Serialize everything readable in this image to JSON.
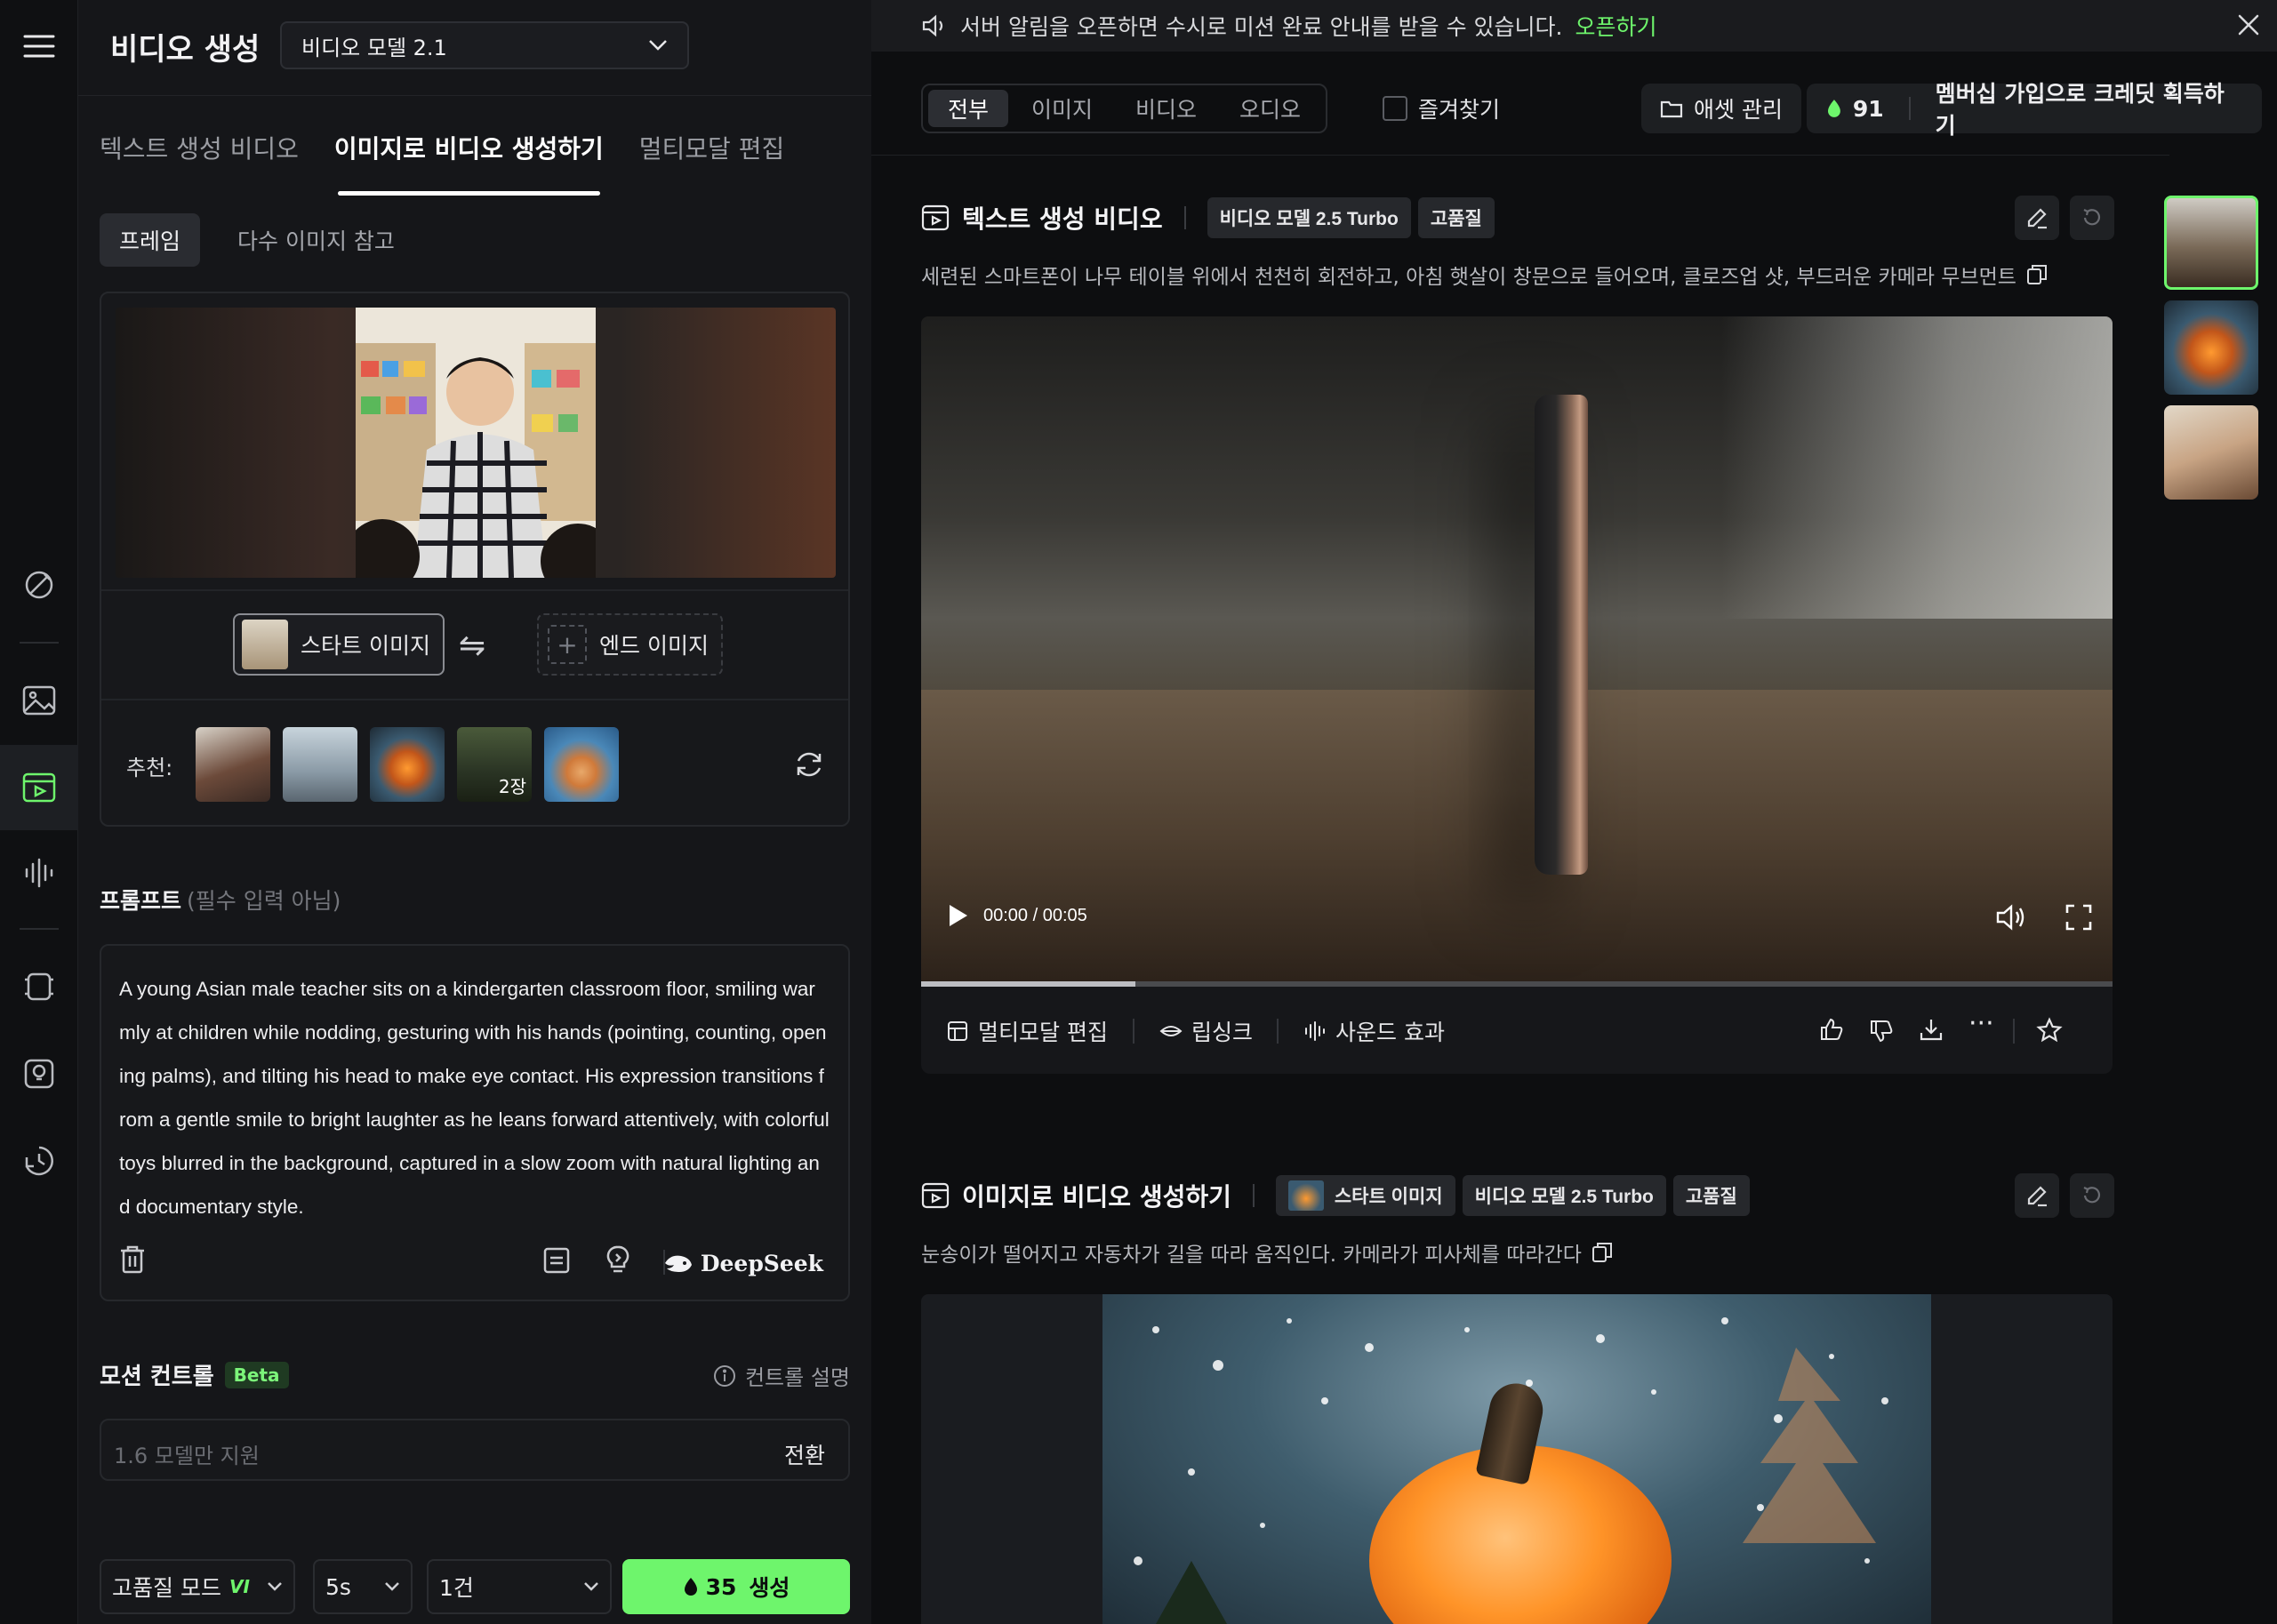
{
  "app": {
    "title": "비디오 생성",
    "model_select": "비디오 모델 2.1"
  },
  "mode_tabs": [
    "텍스트 생성 비디오",
    "이미지로 비디오 생성하기",
    "멀티모달 편집"
  ],
  "sub_tabs": [
    "프레임",
    "다수 이미지 참고"
  ],
  "frames": {
    "start_label": "스타트 이미지",
    "end_label": "엔드 이미지",
    "recommend_label": "추천:",
    "recommend_badge": "2장"
  },
  "prompt": {
    "heading": "프롬프트",
    "optional": "(필수 입력 아님)",
    "text": "A young Asian male teacher sits on a kindergarten classroom floor, smiling warmly at children while nodding, gesturing with his hands (pointing, counting, opening palms), and tilting his head to make eye contact. His expression transitions from a gentle smile to bright laughter as he leans forward attentively, with colorful toys blurred in the background, captured in a slow zoom with natural lighting and documentary style.",
    "deepseek_label": "DeepSeek"
  },
  "motion": {
    "heading": "모션 컨트롤",
    "beta": "Beta",
    "help": "컨트롤 설명",
    "placeholder": "1.6 모델만 지원",
    "switch": "전환"
  },
  "bottom": {
    "quality": "고품질 모드",
    "quality_badge": "VI",
    "duration": "5s",
    "count": "1건",
    "generate_cost": "35",
    "generate_label": "생성"
  },
  "notice": {
    "text": "서버 알림을 오픈하면 수시로 미션 완료 안내를 받을 수 있습니다.",
    "link": "오픈하기"
  },
  "filters": [
    "전부",
    "이미지",
    "비디오",
    "오디오"
  ],
  "favorites_label": "즐겨찾기",
  "asset_button": "애셋 관리",
  "credits": "91",
  "membership": "멤버십 가입으로 크레딧 획득하기",
  "results": [
    {
      "title": "텍스트 생성 비디오",
      "chips": [
        "비디오 모델 2.5 Turbo",
        "고품질"
      ],
      "description": "세련된 스마트폰이 나무 테이블 위에서 천천히 회전하고, 아침 햇살이 창문으로 들어오며, 클로즈업 샷, 부드러운 카메라 무브먼트",
      "time": "00:00 / 00:05",
      "progress": 0.18,
      "actions": [
        "멀티모달 편집",
        "립싱크",
        "사운드 효과"
      ]
    },
    {
      "title": "이미지로 비디오 생성하기",
      "chips": [
        "스타트 이미지",
        "비디오 모델 2.5 Turbo",
        "고품질"
      ],
      "description": "눈송이가 떨어지고 자동차가 길을 따라 움직인다. 카메라가 피사체를 따라간다"
    }
  ],
  "colors": {
    "accent": "#6ef56c",
    "bg": "#0d0e10",
    "panel": "#151619"
  }
}
